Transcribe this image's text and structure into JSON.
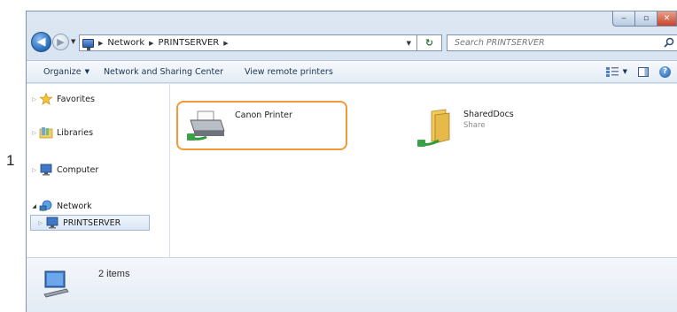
{
  "step_number": "1",
  "window": {
    "caption": {
      "min": "‒",
      "max": "▫",
      "close": "✕"
    },
    "address": {
      "root": "Network",
      "current": "PRINTSERVER"
    },
    "search": {
      "placeholder": "Search PRINTSERVER"
    }
  },
  "toolbar": {
    "organize_label": "Organize",
    "network_sharing_label": "Network and Sharing Center",
    "view_printers_label": "View remote printers"
  },
  "nav": {
    "items": [
      {
        "label": "Favorites",
        "icon": "star-icon"
      },
      {
        "label": "Libraries",
        "icon": "libraries-icon"
      },
      {
        "label": "Computer",
        "icon": "computer-icon"
      },
      {
        "label": "Network",
        "icon": "network-icon"
      },
      {
        "label": "PRINTSERVER",
        "icon": "computer-icon"
      }
    ]
  },
  "files": [
    {
      "name": "Canon Printer",
      "icon": "printer-icon",
      "highlighted": true
    },
    {
      "name": "SharedDocs",
      "subtitle": "Share",
      "icon": "shared-folder-icon"
    }
  ],
  "status": {
    "item_count": "2 items"
  },
  "colors": {
    "highlight_border": "#f29a36",
    "accent": "#2a6fbf"
  }
}
